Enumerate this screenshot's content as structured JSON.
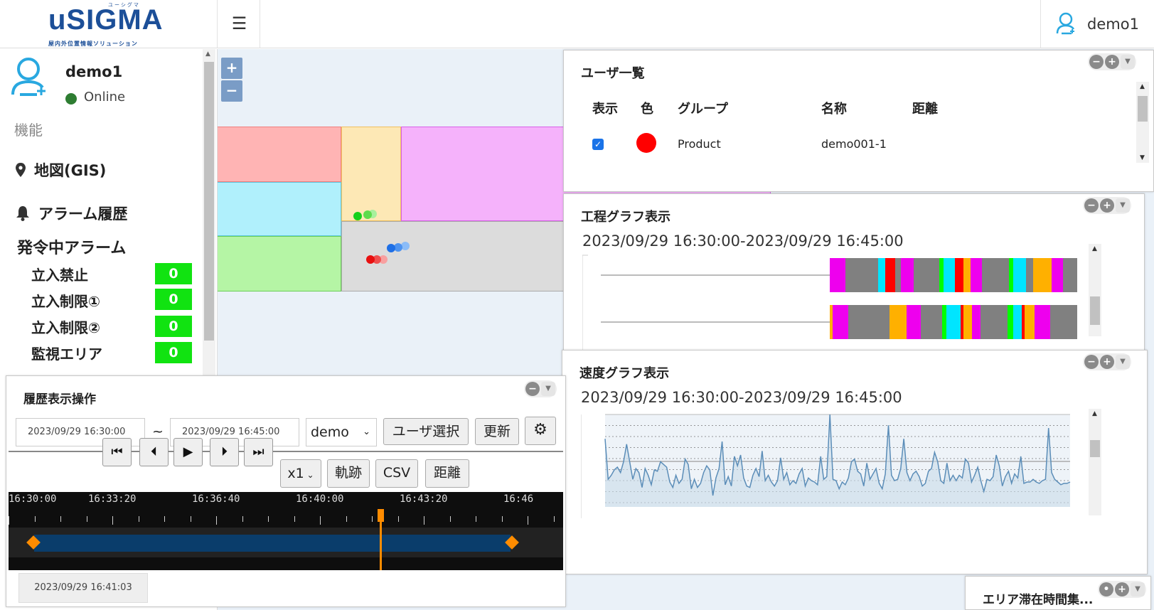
{
  "header": {
    "logo_text": "uSIGMA",
    "logo_ruby": "ユーシグマ",
    "logo_sub": "屋内外位置情報ソリューション",
    "menu_icon": "hamburger-icon",
    "user_name": "demo1"
  },
  "sidebar": {
    "profile_name": "demo1",
    "status": "Online",
    "section_label": "機能",
    "nav": [
      {
        "label": "地図(GIS)",
        "icon": "map-marker-icon"
      },
      {
        "label": "アラーム履歴",
        "icon": "bell-icon"
      }
    ],
    "alarm_heading": "発令中アラーム",
    "alarms": [
      {
        "label": "立入禁止",
        "count": "0"
      },
      {
        "label": "立入制限①",
        "count": "0"
      },
      {
        "label": "立入制限②",
        "count": "0"
      },
      {
        "label": "監視エリア",
        "count": "0"
      }
    ],
    "badge_color": "#11e311"
  },
  "map": {
    "zoom_in": "+",
    "zoom_out": "−"
  },
  "user_list": {
    "title": "ユーザ一覧",
    "headers": [
      "表示",
      "色",
      "グループ",
      "名称",
      "距離"
    ],
    "rows": [
      {
        "visible": true,
        "color": "#ff0000",
        "group": "Product",
        "name": "demo001-1",
        "distance": ""
      }
    ]
  },
  "process_graph": {
    "title": "工程グラフ表示",
    "range": "2023/09/29 16:30:00-2023/09/29 16:45:00"
  },
  "speed_graph": {
    "title": "速度グラフ表示",
    "range": "2023/09/29 16:30:00-2023/09/29 16:45:00"
  },
  "area_panel": {
    "title": "エリア滞在時間集..."
  },
  "playback": {
    "title": "履歴表示操作",
    "start": "2023/09/29 16:30:00",
    "tilde": "~",
    "end": "2023/09/29 16:45:00",
    "user_group": "demo",
    "select_user": "ユーザ選択",
    "refresh": "更新",
    "speed": "x1",
    "track": "軌跡",
    "csv": "CSV",
    "distance": "距離",
    "timeline_labels": [
      "16:30:00",
      "16:33:20",
      "16:36:40",
      "16:40:00",
      "16:43:20",
      "16:46"
    ],
    "current_time": "2023/09/29 16:41:03"
  }
}
